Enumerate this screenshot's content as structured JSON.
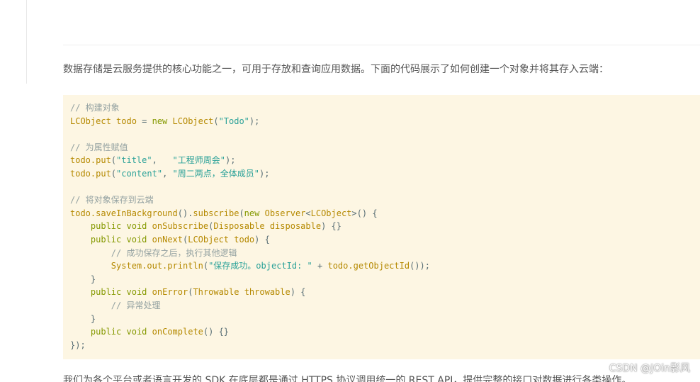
{
  "article": {
    "intro": "数据存储是云服务提供的核心功能之一，可用于存放和查询应用数据。下面的代码展示了如何创建一个对象并将其存入云端：",
    "bottom_text": "我们为各个平台或者语言开发的 SDK 在底层都是通过 HTTPS 协议调用统一的 REST API，提供完整的接口对数据进行各类操作。"
  },
  "watermark": "CSDN @JOin影风",
  "code": {
    "language": "java",
    "lines": [
      [
        {
          "t": "comment",
          "v": "// 构建对象"
        }
      ],
      [
        {
          "t": "ident",
          "v": "LCObject todo"
        },
        {
          "t": "plain",
          "v": " = "
        },
        {
          "t": "keyword",
          "v": "new"
        },
        {
          "t": "plain",
          "v": " "
        },
        {
          "t": "ident",
          "v": "LCObject"
        },
        {
          "t": "plain",
          "v": "("
        },
        {
          "t": "string",
          "v": "\"Todo\""
        },
        {
          "t": "plain",
          "v": ");"
        }
      ],
      [],
      [
        {
          "t": "comment",
          "v": "// 为属性赋值"
        }
      ],
      [
        {
          "t": "ident",
          "v": "todo.put"
        },
        {
          "t": "plain",
          "v": "("
        },
        {
          "t": "string",
          "v": "\"title\""
        },
        {
          "t": "plain",
          "v": ",   "
        },
        {
          "t": "string",
          "v": "\"工程师周会\""
        },
        {
          "t": "plain",
          "v": ");"
        }
      ],
      [
        {
          "t": "ident",
          "v": "todo.put"
        },
        {
          "t": "plain",
          "v": "("
        },
        {
          "t": "string",
          "v": "\"content\""
        },
        {
          "t": "plain",
          "v": ", "
        },
        {
          "t": "string",
          "v": "\"周二两点，全体成员\""
        },
        {
          "t": "plain",
          "v": ");"
        }
      ],
      [],
      [
        {
          "t": "comment",
          "v": "// 将对象保存到云端"
        }
      ],
      [
        {
          "t": "ident",
          "v": "todo.saveInBackground"
        },
        {
          "t": "plain",
          "v": "()."
        },
        {
          "t": "ident",
          "v": "subscribe"
        },
        {
          "t": "plain",
          "v": "("
        },
        {
          "t": "keyword",
          "v": "new"
        },
        {
          "t": "plain",
          "v": " "
        },
        {
          "t": "ident",
          "v": "Observer"
        },
        {
          "t": "plain",
          "v": "<"
        },
        {
          "t": "ident",
          "v": "LCObject"
        },
        {
          "t": "plain",
          "v": ">() {"
        }
      ],
      [
        {
          "t": "plain",
          "v": "    "
        },
        {
          "t": "keyword",
          "v": "public"
        },
        {
          "t": "plain",
          "v": " "
        },
        {
          "t": "keyword",
          "v": "void"
        },
        {
          "t": "plain",
          "v": " "
        },
        {
          "t": "ident",
          "v": "onSubscribe"
        },
        {
          "t": "plain",
          "v": "("
        },
        {
          "t": "ident",
          "v": "Disposable disposable"
        },
        {
          "t": "plain",
          "v": ") {}"
        }
      ],
      [
        {
          "t": "plain",
          "v": "    "
        },
        {
          "t": "keyword",
          "v": "public"
        },
        {
          "t": "plain",
          "v": " "
        },
        {
          "t": "keyword",
          "v": "void"
        },
        {
          "t": "plain",
          "v": " "
        },
        {
          "t": "ident",
          "v": "onNext"
        },
        {
          "t": "plain",
          "v": "("
        },
        {
          "t": "ident",
          "v": "LCObject todo"
        },
        {
          "t": "plain",
          "v": ") {"
        }
      ],
      [
        {
          "t": "plain",
          "v": "        "
        },
        {
          "t": "comment",
          "v": "// 成功保存之后，执行其他逻辑"
        }
      ],
      [
        {
          "t": "plain",
          "v": "        "
        },
        {
          "t": "ident",
          "v": "System.out.println"
        },
        {
          "t": "plain",
          "v": "("
        },
        {
          "t": "string",
          "v": "\"保存成功。objectId: \""
        },
        {
          "t": "plain",
          "v": " + "
        },
        {
          "t": "ident",
          "v": "todo.getObjectId"
        },
        {
          "t": "plain",
          "v": "());"
        }
      ],
      [
        {
          "t": "plain",
          "v": "    }"
        }
      ],
      [
        {
          "t": "plain",
          "v": "    "
        },
        {
          "t": "keyword",
          "v": "public"
        },
        {
          "t": "plain",
          "v": " "
        },
        {
          "t": "keyword",
          "v": "void"
        },
        {
          "t": "plain",
          "v": " "
        },
        {
          "t": "ident",
          "v": "onError"
        },
        {
          "t": "plain",
          "v": "("
        },
        {
          "t": "ident",
          "v": "Throwable throwable"
        },
        {
          "t": "plain",
          "v": ") {"
        }
      ],
      [
        {
          "t": "plain",
          "v": "        "
        },
        {
          "t": "comment",
          "v": "// 异常处理"
        }
      ],
      [
        {
          "t": "plain",
          "v": "    }"
        }
      ],
      [
        {
          "t": "plain",
          "v": "    "
        },
        {
          "t": "keyword",
          "v": "public"
        },
        {
          "t": "plain",
          "v": " "
        },
        {
          "t": "keyword",
          "v": "void"
        },
        {
          "t": "plain",
          "v": " "
        },
        {
          "t": "ident",
          "v": "onComplete"
        },
        {
          "t": "plain",
          "v": "() {}"
        }
      ],
      [
        {
          "t": "plain",
          "v": "});"
        }
      ]
    ]
  }
}
